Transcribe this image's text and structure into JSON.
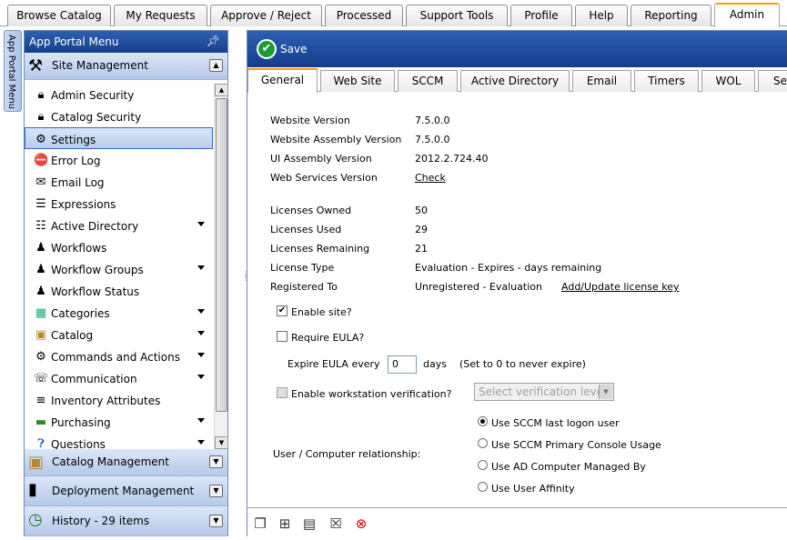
{
  "top_tabs": [
    "Browse Catalog",
    "My Requests",
    "Approve / Reject",
    "Processed",
    "Support Tools",
    "Profile",
    "Help",
    "Reporting",
    "Admin"
  ],
  "side_strip_label": "App Portal Menu",
  "menu": {
    "header": "App Portal Menu",
    "site_management": "Site Management",
    "items": [
      "Admin Security",
      "Catalog Security",
      "Settings",
      "Error Log",
      "Email Log",
      "Expressions",
      "Active Directory",
      "Workflows",
      "Workflow Groups",
      "Workflow Status",
      "Categories",
      "Catalog",
      "Commands and Actions",
      "Communication",
      "Inventory Attributes",
      "Purchasing",
      "Questions"
    ],
    "catalog_management": "Catalog Management",
    "deployment_management": "Deployment Management",
    "history": "History - 29 items"
  },
  "toolbar": {
    "save_label": "Save"
  },
  "sub_tabs": [
    "General",
    "Web Site",
    "SCCM",
    "Active Directory",
    "Email",
    "Timers",
    "WOL",
    "Se"
  ],
  "general": {
    "website_version_label": "Website Version",
    "website_version": "7.5.0.0",
    "assembly_version_label": "Website Assembly Version",
    "assembly_version": "7.5.0.0",
    "ui_assembly_label": "UI Assembly Version",
    "ui_assembly": "2012.2.724.40",
    "web_services_label": "Web Services Version",
    "web_services_link": "Check",
    "licenses_owned_label": "Licenses Owned",
    "licenses_owned": "50",
    "licenses_used_label": "Licenses Used",
    "licenses_used": "29",
    "licenses_remaining_label": "Licenses Remaining",
    "licenses_remaining": "21",
    "license_type_label": "License Type",
    "license_type": "Evaluation - Expires - days remaining",
    "registered_to_label": "Registered To",
    "registered_to": "Unregistered - Evaluation",
    "add_update_license": "Add/Update license key",
    "enable_site": "Enable site?",
    "require_eula": "Require EULA?",
    "expire_eula_prefix": "Expire EULA every",
    "expire_eula_value": "0",
    "expire_eula_suffix": "days",
    "expire_eula_hint": "(Set to 0 to never expire)",
    "enable_ws_verification": "Enable workstation verification?",
    "verification_placeholder": "Select verification level",
    "user_computer_label": "User / Computer relationship:",
    "radio_options": [
      "Use SCCM last logon user",
      "Use SCCM Primary Console Usage",
      "Use AD Computer Managed By",
      "Use User Affinity"
    ]
  }
}
